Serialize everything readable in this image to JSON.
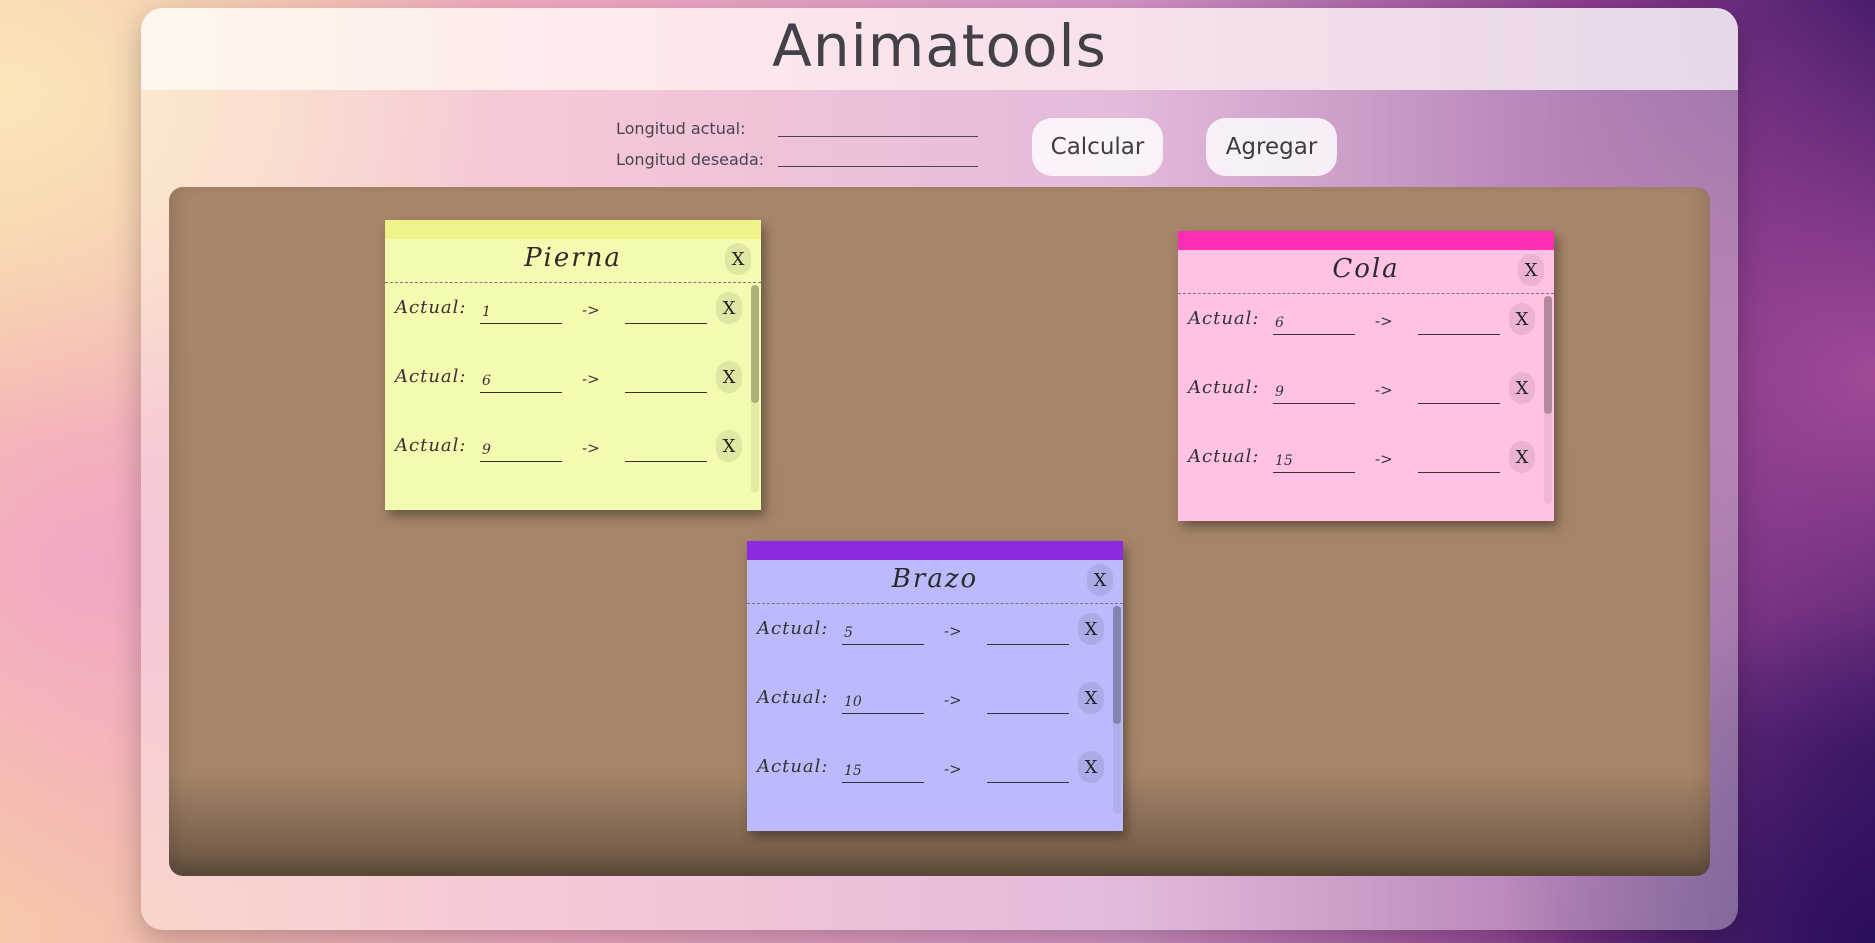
{
  "app": {
    "title": "Animatools"
  },
  "controls": {
    "current_length_label": "Longitud actual:",
    "desired_length_label": "Longitud deseada:",
    "current_length_value": "",
    "desired_length_value": "",
    "calculate_button": "Calcular",
    "add_button": "Agregar"
  },
  "notes": [
    {
      "name": "Pierna",
      "close": "X",
      "strip_color": "#eef48a",
      "body_color": "#f2fbb0",
      "rows": [
        {
          "label": "Actual:",
          "current": "1",
          "arrow": "->",
          "target": "",
          "remove": "X"
        },
        {
          "label": "Actual:",
          "current": "6",
          "arrow": "->",
          "target": "",
          "remove": "X"
        },
        {
          "label": "Actual:",
          "current": "9",
          "arrow": "->",
          "target": "",
          "remove": "X"
        }
      ]
    },
    {
      "name": "Cola",
      "close": "X",
      "strip_color": "#ff2fb4",
      "body_color": "#ffc2e4",
      "rows": [
        {
          "label": "Actual:",
          "current": "6",
          "arrow": "->",
          "target": "",
          "remove": "X"
        },
        {
          "label": "Actual:",
          "current": "9",
          "arrow": "->",
          "target": "",
          "remove": "X"
        },
        {
          "label": "Actual:",
          "current": "15",
          "arrow": "->",
          "target": "",
          "remove": "X"
        }
      ]
    },
    {
      "name": "Brazo",
      "close": "X",
      "strip_color": "#8a2be2",
      "body_color": "#babafc",
      "rows": [
        {
          "label": "Actual:",
          "current": "5",
          "arrow": "->",
          "target": "",
          "remove": "X"
        },
        {
          "label": "Actual:",
          "current": "10",
          "arrow": "->",
          "target": "",
          "remove": "X"
        },
        {
          "label": "Actual:",
          "current": "15",
          "arrow": "->",
          "target": "",
          "remove": "X"
        }
      ]
    }
  ]
}
